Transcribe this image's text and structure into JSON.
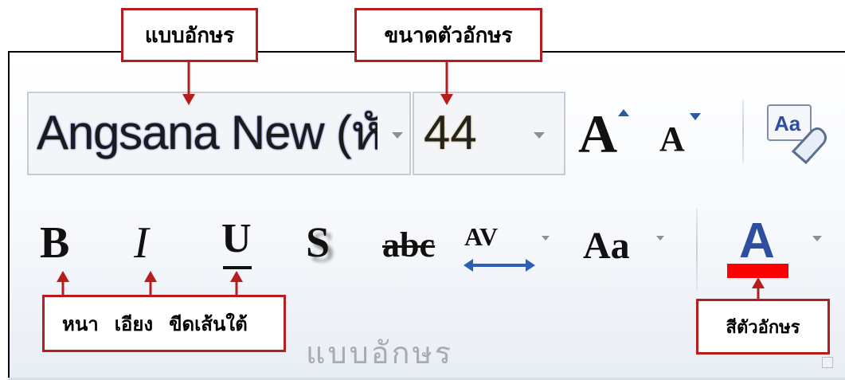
{
  "font_group": {
    "font_name": "Angsana New (หัวเ",
    "font_size": "44",
    "group_label": "แบบอักษร",
    "grow_glyph": "A",
    "shrink_glyph": "A",
    "bold_glyph": "B",
    "italic_glyph": "I",
    "underline_glyph": "U",
    "shadow_glyph": "S",
    "strike_glyph": "abc",
    "spacing_glyph": "AV",
    "case_glyph": "Aa",
    "color_glyph": "A"
  },
  "annotations": {
    "font_label": "แบบอักษร",
    "size_label": "ขนาดตัวอักษร",
    "bold_label": "หนา",
    "italic_label": "เอียง",
    "underline_label": "ขีดเส้นใต้",
    "color_label": "สีตัวอักษร"
  },
  "colors": {
    "annotation_border": "#b81d1d",
    "font_color_swatch": "#ff0000",
    "icon_blue": "#2c4fa0"
  }
}
